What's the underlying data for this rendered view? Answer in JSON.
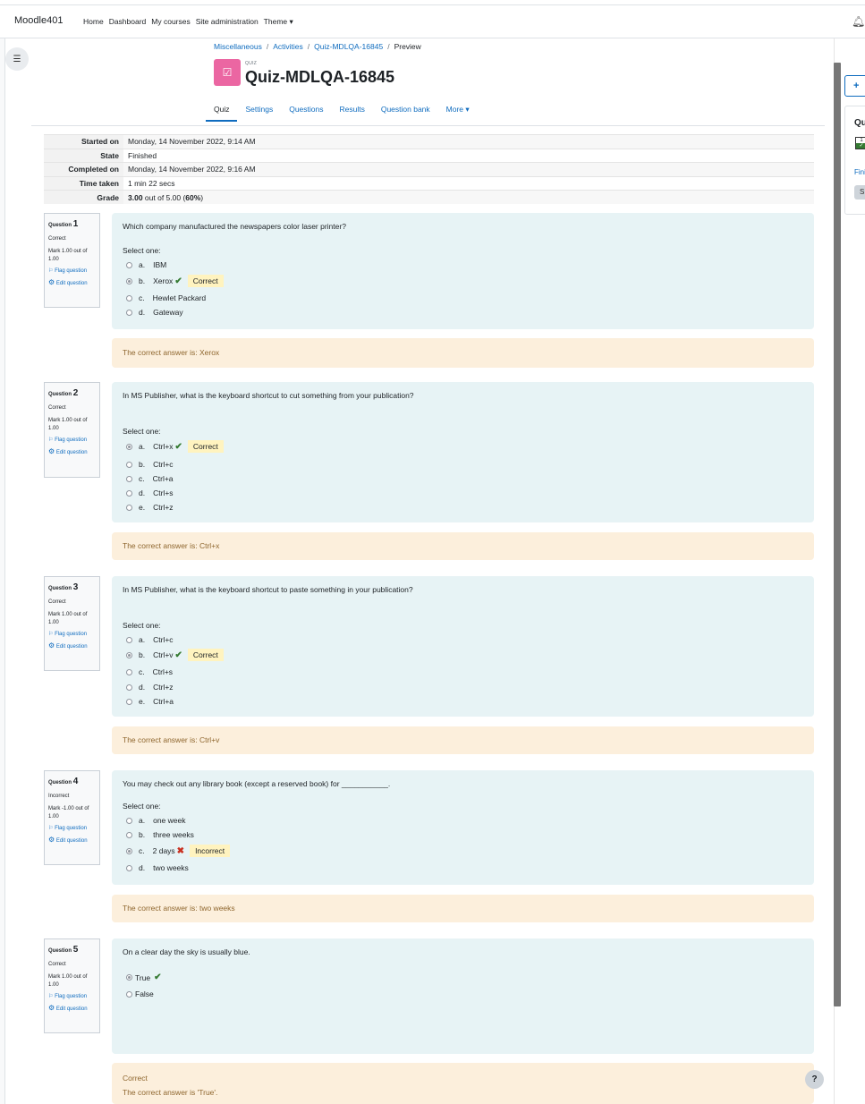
{
  "navbar": {
    "brand": "Moodle401",
    "items": [
      "Home",
      "Dashboard",
      "My courses",
      "Site administration",
      "Theme ▾"
    ]
  },
  "breadcrumb": [
    "Miscellaneous",
    "Activities",
    "Quiz-MDLQA-16845",
    "Preview"
  ],
  "header": {
    "module_label": "QUIZ",
    "title": "Quiz-MDLQA-16845",
    "icon_color": "#eb66a2"
  },
  "tabs": [
    "Quiz",
    "Settings",
    "Questions",
    "Results",
    "Question bank",
    "More ▾"
  ],
  "summary": [
    {
      "label": "Started on",
      "value": "Monday, 14 November 2022, 9:14 AM"
    },
    {
      "label": "State",
      "value": "Finished"
    },
    {
      "label": "Completed on",
      "value": "Monday, 14 November 2022, 9:16 AM"
    },
    {
      "label": "Time taken",
      "value": "1 min 22 secs"
    },
    {
      "label": "Grade",
      "grade_value": "3.00",
      "grade_rest": " out of 5.00 (",
      "grade_pct": "60%",
      "grade_close": ")"
    }
  ],
  "labels": {
    "question": "Question",
    "flag": "Flag question",
    "edit": "Edit question",
    "select_one": "Select one:",
    "correct_badge": "Correct",
    "incorrect_badge": "Incorrect"
  },
  "questions": [
    {
      "number": "1",
      "state": "Correct",
      "grade": "Mark 1.00 out of 1.00",
      "text": "Which company manufactured the newspapers color laser printer?",
      "options": [
        {
          "num": "a.",
          "text": "IBM"
        },
        {
          "num": "b.",
          "text": "Xerox",
          "checked": true,
          "mark": "correct"
        },
        {
          "num": "c.",
          "text": "Hewlet Packard"
        },
        {
          "num": "d.",
          "text": "Gateway"
        }
      ],
      "feedback": "The correct answer is: Xerox"
    },
    {
      "number": "2",
      "state": "Correct",
      "grade": "Mark 1.00 out of 1.00",
      "text": "In MS Publisher, what is the keyboard shortcut to cut something from your publication?",
      "options": [
        {
          "num": "a.",
          "text": "Ctrl+x",
          "checked": true,
          "mark": "correct"
        },
        {
          "num": "b.",
          "text": "Ctrl+c"
        },
        {
          "num": "c.",
          "text": "Ctrl+a"
        },
        {
          "num": "d.",
          "text": "Ctrl+s"
        },
        {
          "num": "e.",
          "text": "Ctrl+z"
        }
      ],
      "feedback": "The correct answer is: Ctrl+x"
    },
    {
      "number": "3",
      "state": "Correct",
      "grade": "Mark 1.00 out of 1.00",
      "text": "In MS Publisher, what is the keyboard shortcut to paste something in your publication?",
      "options": [
        {
          "num": "a.",
          "text": "Ctrl+c"
        },
        {
          "num": "b.",
          "text": "Ctrl+v",
          "checked": true,
          "mark": "correct"
        },
        {
          "num": "c.",
          "text": "Ctrl+s"
        },
        {
          "num": "d.",
          "text": "Ctrl+z"
        },
        {
          "num": "e.",
          "text": "Ctrl+a"
        }
      ],
      "feedback": "The correct answer is: Ctrl+v"
    },
    {
      "number": "4",
      "state": "Incorrect",
      "grade": "Mark -1.00 out of 1.00",
      "text": "You may check out any library book (except a reserved book) for ___________.",
      "options": [
        {
          "num": "a.",
          "text": "one week"
        },
        {
          "num": "b.",
          "text": "three weeks"
        },
        {
          "num": "c.",
          "text": "2 days",
          "checked": true,
          "mark": "incorrect"
        },
        {
          "num": "d.",
          "text": "two weeks"
        }
      ],
      "feedback": "The correct answer is: two weeks"
    },
    {
      "number": "5",
      "state": "Correct",
      "grade": "Mark 1.00 out of 1.00",
      "text": "On a clear day the sky is usually blue.",
      "options": [
        {
          "num": "",
          "text": "True",
          "checked": true,
          "mark": "correct"
        },
        {
          "num": "",
          "text": "False"
        }
      ],
      "feedback_state": "Correct",
      "feedback": "The correct answer is 'True'."
    }
  ],
  "quiz_nav": {
    "title": "Qu",
    "cell": "1",
    "finish": "Fini",
    "start": "S"
  },
  "help": "?",
  "colors": {
    "link": "#0f6cbf",
    "question_bg": "#e7f3f5",
    "feedback_bg": "#fcefdc",
    "correct": "#357a32",
    "incorrect": "#ca3120",
    "badge_bg": "#fff3bf"
  }
}
